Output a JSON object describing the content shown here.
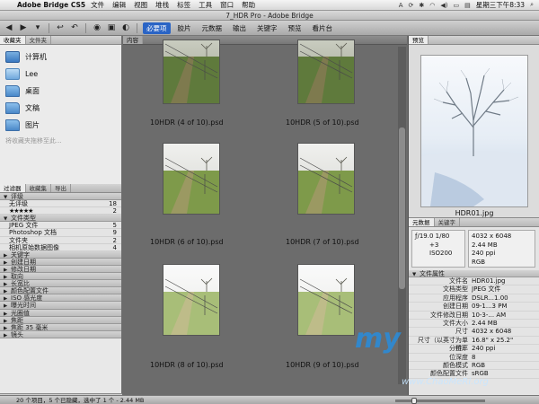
{
  "menubar": {
    "app": "Adobe Bridge CS5",
    "items": [
      "文件",
      "编辑",
      "视图",
      "堆栈",
      "标签",
      "工具",
      "窗口",
      "帮助"
    ],
    "clock": "星期三下午8:33"
  },
  "window": {
    "title": "7_HDR Pro - Adobe Bridge"
  },
  "toolbar": {
    "workspaces": [
      "必要项",
      "胶片",
      "元数据",
      "输出",
      "关键字",
      "预览",
      "看片台"
    ],
    "active_workspace": "必要项"
  },
  "left": {
    "tabs": [
      "收藏夹",
      "文件夹"
    ],
    "favorites": [
      {
        "label": "计算机",
        "type": "computer"
      },
      {
        "label": "Lee",
        "type": "user"
      },
      {
        "label": "桌面",
        "type": "folder"
      },
      {
        "label": "文稿",
        "type": "folder"
      },
      {
        "label": "图片",
        "type": "folder"
      }
    ],
    "fav_hint": "将收藏夹拖移至此...",
    "filter_tabs": [
      "过滤器",
      "收藏集",
      "导出"
    ],
    "filter_sections": [
      {
        "title": "评级",
        "open": true,
        "rows": [
          {
            "label": "无评级",
            "count": "18"
          },
          {
            "label": "★★★★★",
            "count": "2"
          }
        ]
      },
      {
        "title": "文件类型",
        "open": true,
        "rows": [
          {
            "label": "JPEG 文件",
            "count": "5"
          },
          {
            "label": "Photoshop 文档",
            "count": "9"
          },
          {
            "label": "文件夹",
            "count": "2"
          },
          {
            "label": "相机原始数据图像",
            "count": "4"
          }
        ]
      },
      {
        "title": "关键字",
        "open": false,
        "rows": []
      },
      {
        "title": "创建日期",
        "open": false,
        "rows": []
      },
      {
        "title": "修改日期",
        "open": false,
        "rows": []
      },
      {
        "title": "取向",
        "open": false,
        "rows": []
      },
      {
        "title": "长宽比",
        "open": false,
        "rows": []
      },
      {
        "title": "颜色配置文件",
        "open": false,
        "rows": []
      },
      {
        "title": "ISO 感光度",
        "open": false,
        "rows": []
      },
      {
        "title": "曝光时间",
        "open": false,
        "rows": []
      },
      {
        "title": "光圈值",
        "open": false,
        "rows": []
      },
      {
        "title": "焦距",
        "open": false,
        "rows": []
      },
      {
        "title": "焦距 35 毫米",
        "open": false,
        "rows": []
      },
      {
        "title": "镜头",
        "open": false,
        "rows": []
      }
    ]
  },
  "content": {
    "tab": "内容",
    "thumbs": [
      {
        "caption": "10HDR (4 of 10).psd",
        "tone": "dark"
      },
      {
        "caption": "10HDR (5 of 10).psd",
        "tone": "dark"
      },
      {
        "caption": "10HDR (6 of 10).psd",
        "tone": "mid"
      },
      {
        "caption": "10HDR (7 of 10).psd",
        "tone": "mid"
      },
      {
        "caption": "10HDR (8 of 10).psd",
        "tone": "light"
      },
      {
        "caption": "10HDR (9 of 10).psd",
        "tone": "light"
      }
    ]
  },
  "right": {
    "preview_tab": "预览",
    "preview_caption": "HDR01.jpg",
    "meta_tabs": [
      "元数据",
      "关键字"
    ],
    "exif_left": [
      "ƒ/19.0",
      "1/80",
      "+3",
      "ISO200"
    ],
    "exif_right": [
      "4032 x 6048",
      "2.44 MB",
      "240 ppi",
      "RGB"
    ],
    "section_title": "文件属性",
    "rows": [
      {
        "label": "文件名",
        "value": "HDR01.jpg"
      },
      {
        "label": "文档类型",
        "value": "JPEG 文件"
      },
      {
        "label": "应用程序",
        "value": "DSLR...1.00"
      },
      {
        "label": "创建日期",
        "value": "09-1...3 PM"
      },
      {
        "label": "文件修改日期",
        "value": "10-3-... AM"
      },
      {
        "label": "文件大小",
        "value": "2.44 MB"
      },
      {
        "label": "尺寸",
        "value": "4032 x 6048"
      },
      {
        "label": "尺寸（以英寸为单位）",
        "value": "16.8\" x 25.2\""
      },
      {
        "label": "分辨率",
        "value": "240 ppi"
      },
      {
        "label": "位深度",
        "value": "8"
      },
      {
        "label": "颜色模式",
        "value": "RGB"
      },
      {
        "label": "颜色配置文件",
        "value": "sRGB"
      }
    ]
  },
  "status": {
    "text": "20 个项目，5 个已隐藏，选中了 1 个 - 2.44 MB"
  },
  "watermark": {
    "brand": "my",
    "url": "www.ChaoMeRi.org"
  }
}
